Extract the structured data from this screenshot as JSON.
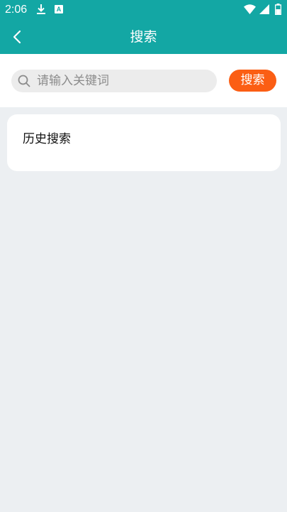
{
  "status_bar": {
    "time": "2:06",
    "icons": [
      "download-icon",
      "a-badge-icon",
      "wifi-icon",
      "signal-icon",
      "battery-icon"
    ]
  },
  "app_bar": {
    "title": "搜索",
    "back_icon": "chevron-left-icon"
  },
  "search": {
    "placeholder": "请输入关键词",
    "value": "",
    "button_label": "搜索",
    "icon": "search-icon"
  },
  "history": {
    "title": "历史搜索",
    "items": []
  },
  "colors": {
    "primary": "#13A7A4",
    "accent": "#FB5E14",
    "background": "#ECEFF2"
  }
}
